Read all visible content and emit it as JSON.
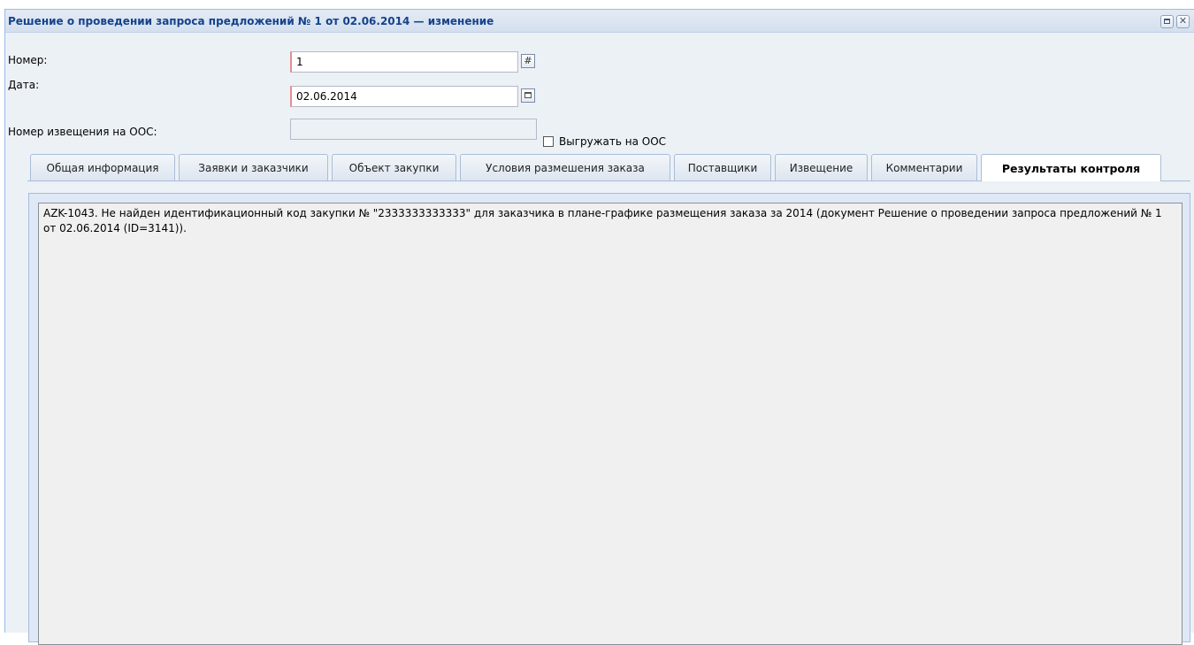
{
  "window": {
    "title": "Решение о проведении запроса предложений № 1 от 02.06.2014 — изменение",
    "maximize_icon": "maximize-icon",
    "close_icon": "close-icon",
    "close_glyph": "✕"
  },
  "form": {
    "number_label": "Номер:",
    "number_value": "1",
    "number_icon": "hash-icon",
    "number_glyph": "#",
    "date_label": "Дата:",
    "date_value": "02.06.2014",
    "date_icon": "calendar-icon",
    "notice_label": "Номер извещения на ООС:",
    "notice_value": "",
    "export_checkbox_label": "Выгружать на ООС",
    "export_checked": false
  },
  "tabs": [
    {
      "label": "Общая информация",
      "active": false
    },
    {
      "label": "Заявки и заказчики",
      "active": false
    },
    {
      "label": "Объект закупки",
      "active": false
    },
    {
      "label": "Условия размешения заказа",
      "active": false
    },
    {
      "label": "Поставщики",
      "active": false
    },
    {
      "label": "Извещение",
      "active": false
    },
    {
      "label": "Комментарии",
      "active": false
    },
    {
      "label": "Результаты контроля",
      "active": true
    }
  ],
  "control_results": {
    "text": "AZK-1043. Не найден идентификационный код закупки № \"2333333333333\" для заказчика в плане-графике размещения заказа за 2014 (документ Решение о проведении запроса предложений № 1 от 02.06.2014 (ID=3141))."
  },
  "colors": {
    "title_text": "#15428b",
    "required_marker": "#e38f8f",
    "tab_border": "#a9bdd8",
    "panel_background": "#dfe8f6"
  }
}
